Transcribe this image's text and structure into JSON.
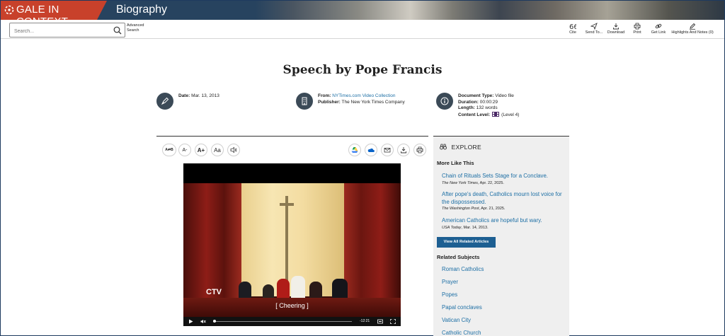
{
  "brand": {
    "name": "GALE IN CONTEXT",
    "product": "Biography"
  },
  "search": {
    "placeholder": "Search...",
    "advanced_label": "Advanced Search"
  },
  "tools": [
    {
      "label": "Cite",
      "icon": "quote-icon"
    },
    {
      "label": "Send To...",
      "icon": "send-icon"
    },
    {
      "label": "Download",
      "icon": "download-icon"
    },
    {
      "label": "Print",
      "icon": "print-icon"
    },
    {
      "label": "Get Link",
      "icon": "link-icon"
    },
    {
      "label": "Highlights And Notes (0)",
      "icon": "pencil-icon"
    }
  ],
  "document": {
    "title": "Speech by Pope Francis",
    "date_label": "Date:",
    "date": "Mar. 13, 2013",
    "from_label": "From:",
    "from": "NYTimes.com Video Collection",
    "publisher_label": "Publisher:",
    "publisher": "The New York Times Company",
    "doctype_label": "Document Type:",
    "doctype": "Video file",
    "duration_label": "Duration:",
    "duration": "00:00:29",
    "length_label": "Length:",
    "length": "132 words",
    "level_label": "Content Level:",
    "level": "(Level 4)"
  },
  "article_tools": {
    "translate": "A⇄B",
    "font_down": "A-",
    "font_up": "A+",
    "font_style": "Aa"
  },
  "video": {
    "caption": "[ Cheering ]",
    "logo": "CTV",
    "time": "-12:21"
  },
  "explore": {
    "heading": "EXPLORE",
    "more_like_this": "More Like This",
    "articles": [
      {
        "title": "Chain of Rituals Sets Stage for a Conclave.",
        "source": "The New York Times",
        "date": ", Apr. 22, 2025."
      },
      {
        "title": "After pope's death, Catholics mourn lost voice for the dispossessed.",
        "source": "The Washington Post",
        "date": ", Apr. 21, 2025."
      },
      {
        "title": "American Catholics are hopeful but wary.",
        "source": "USA Today",
        "date": ", Mar. 14, 2013."
      }
    ],
    "view_all": "View All Related Articles",
    "related_subjects": "Related Subjects",
    "subjects": [
      "Roman Catholics",
      "Prayer",
      "Popes",
      "Papal conclaves",
      "Vatican City",
      "Catholic Church"
    ]
  },
  "colors": {
    "brand_red": "#c8412b",
    "header_navy": "#27435f",
    "link_blue": "#1d6fa5",
    "button_blue": "#1d5f92",
    "panel_gray": "#efefef"
  }
}
